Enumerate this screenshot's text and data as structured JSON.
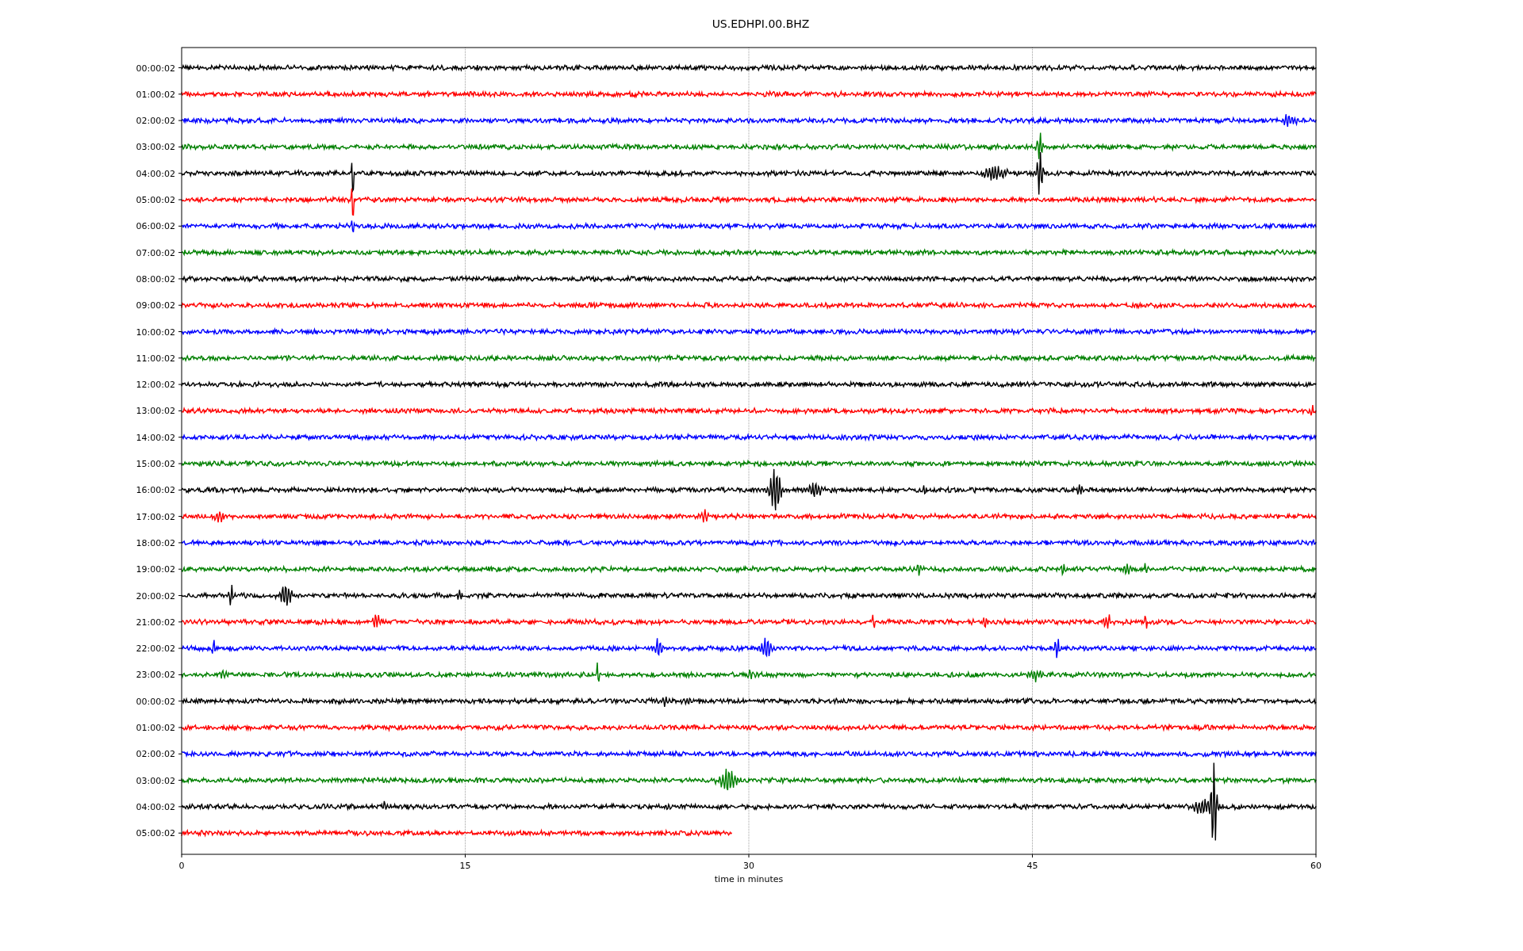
{
  "title": "US.EDHPI.00.BHZ",
  "plot": {
    "traces": [
      {
        "label": "00:00:02",
        "color": "#000000"
      },
      {
        "label": "01:00:02",
        "color": "#ff0000"
      },
      {
        "label": "02:00:02",
        "color": "#0000ff"
      },
      {
        "label": "03:00:02",
        "color": "#008000"
      },
      {
        "label": "04:00:02",
        "color": "#000000"
      },
      {
        "label": "05:00:02",
        "color": "#ff0000"
      },
      {
        "label": "06:00:02",
        "color": "#0000ff"
      },
      {
        "label": "07:00:02",
        "color": "#008000"
      },
      {
        "label": "08:00:02",
        "color": "#000000"
      },
      {
        "label": "09:00:02",
        "color": "#ff0000"
      },
      {
        "label": "10:00:02",
        "color": "#0000ff"
      },
      {
        "label": "11:00:02",
        "color": "#008000"
      },
      {
        "label": "12:00:02",
        "color": "#000000"
      },
      {
        "label": "13:00:02",
        "color": "#ff0000"
      },
      {
        "label": "14:00:02",
        "color": "#0000ff"
      },
      {
        "label": "15:00:02",
        "color": "#008000"
      },
      {
        "label": "16:00:02",
        "color": "#000000"
      },
      {
        "label": "17:00:02",
        "color": "#ff0000"
      },
      {
        "label": "18:00:02",
        "color": "#0000ff"
      },
      {
        "label": "19:00:02",
        "color": "#008000"
      },
      {
        "label": "20:00:02",
        "color": "#000000"
      },
      {
        "label": "21:00:02",
        "color": "#ff0000"
      },
      {
        "label": "22:00:02",
        "color": "#0000ff"
      },
      {
        "label": "23:00:02",
        "color": "#008000"
      },
      {
        "label": "00:00:02",
        "color": "#000000"
      },
      {
        "label": "01:00:02",
        "color": "#ff0000"
      },
      {
        "label": "02:00:02",
        "color": "#0000ff"
      },
      {
        "label": "03:00:02",
        "color": "#008000"
      },
      {
        "label": "04:00:02",
        "color": "#000000"
      },
      {
        "label": "05:00:02",
        "color": "#ff0000"
      }
    ],
    "x_ticks": [
      "0",
      "15",
      "30",
      "45",
      "60"
    ],
    "x_label": "time in minutes"
  }
}
